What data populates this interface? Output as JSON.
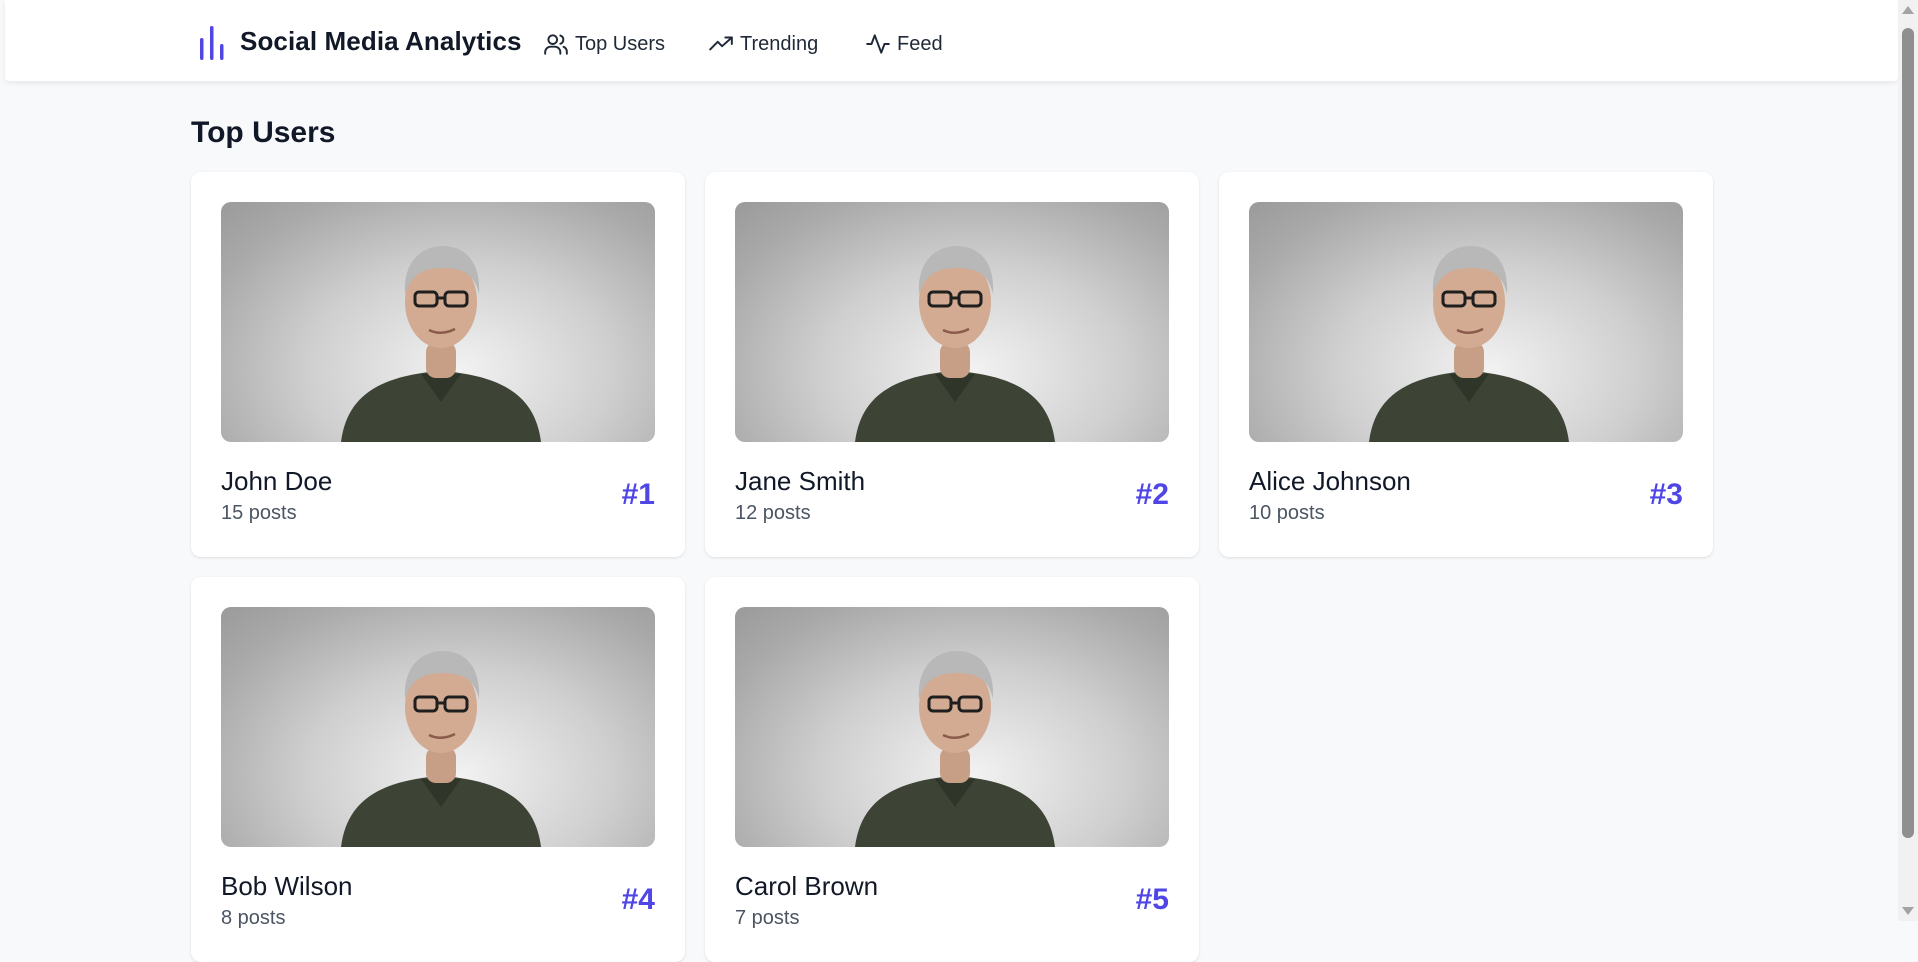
{
  "app": {
    "title": "Social Media Analytics",
    "accent": "#4f46e5"
  },
  "nav": {
    "items": [
      {
        "label": "Top Users",
        "icon": "users-icon"
      },
      {
        "label": "Trending",
        "icon": "trending-up-icon"
      },
      {
        "label": "Feed",
        "icon": "activity-icon"
      }
    ]
  },
  "main": {
    "title": "Top Users",
    "users": [
      {
        "name": "John Doe",
        "posts": "15 posts",
        "rank": "#1"
      },
      {
        "name": "Jane Smith",
        "posts": "12 posts",
        "rank": "#2"
      },
      {
        "name": "Alice Johnson",
        "posts": "10 posts",
        "rank": "#3"
      },
      {
        "name": "Bob Wilson",
        "posts": "8 posts",
        "rank": "#4"
      },
      {
        "name": "Carol Brown",
        "posts": "7 posts",
        "rank": "#5"
      }
    ]
  }
}
